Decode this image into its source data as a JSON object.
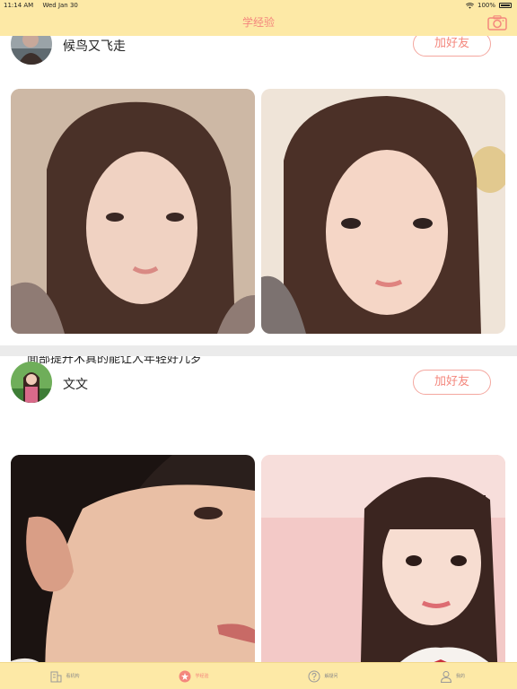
{
  "status_bar": {
    "time": "11:14 AM",
    "date": "Wed Jan 30",
    "battery": "100%"
  },
  "nav": {
    "title": "学经验",
    "camera_icon": "camera-icon"
  },
  "colors": {
    "header_bg": "#fde9a6",
    "accent": "#f4877d",
    "divider": "#ebebeb"
  },
  "posts": [
    {
      "username": "候鸟又飞走",
      "add_friend_label": "加好友",
      "caption": "面部提升术真的能让人年轻好几岁"
    },
    {
      "username": "文文",
      "add_friend_label": "加好友"
    }
  ],
  "tabbar": {
    "items": [
      {
        "label": "看机构",
        "icon": "building-icon"
      },
      {
        "label": "学经验",
        "icon": "star-icon"
      },
      {
        "label": "解疑问",
        "icon": "question-icon"
      },
      {
        "label": "我的",
        "icon": "person-icon"
      }
    ]
  }
}
